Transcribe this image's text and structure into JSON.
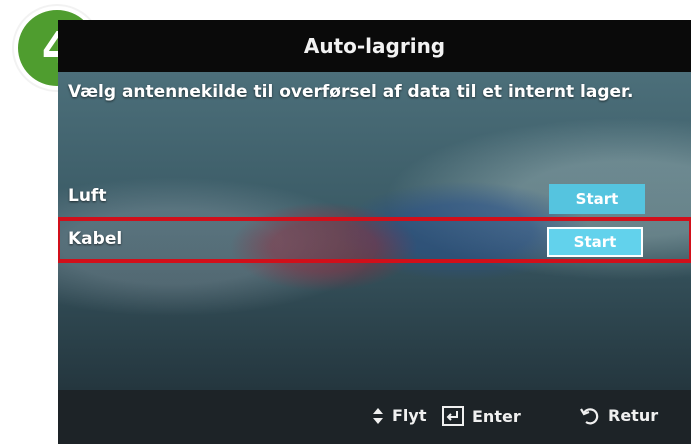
{
  "badge": {
    "number": "4"
  },
  "screen": {
    "title": "Auto-lagring",
    "description": "Vælg antennekilde til overførsel af data til et internt lager.",
    "rows": [
      {
        "label": "Luft",
        "button": "Start",
        "selected": false
      },
      {
        "label": "Kabel",
        "button": "Start",
        "selected": true
      }
    ],
    "footer": {
      "move_label": "Flyt",
      "enter_label": "Enter",
      "return_label": "Retur"
    }
  },
  "colors": {
    "badge_green": "#4f9d2f",
    "button_blue": "#55c4df",
    "selection_red": "#d10f1a"
  }
}
